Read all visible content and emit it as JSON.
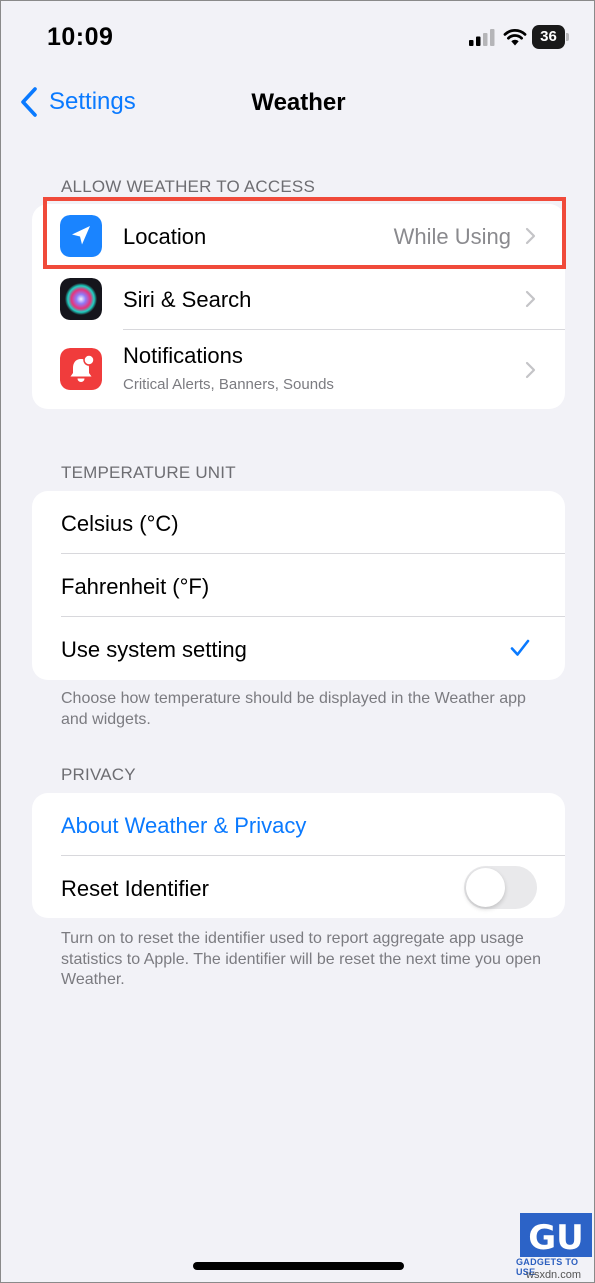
{
  "status_bar": {
    "time": "10:09",
    "battery": "36"
  },
  "nav": {
    "back_label": "Settings",
    "title": "Weather"
  },
  "access_section": {
    "header": "ALLOW WEATHER TO ACCESS",
    "items": [
      {
        "label": "Location",
        "value": "While Using",
        "icon": "location-arrow-icon"
      },
      {
        "label": "Siri & Search",
        "icon": "siri-icon"
      },
      {
        "label": "Notifications",
        "subtitle": "Critical Alerts, Banners, Sounds",
        "icon": "notifications-icon"
      }
    ]
  },
  "temperature_section": {
    "header": "TEMPERATURE UNIT",
    "options": [
      {
        "label": "Celsius (°C)",
        "selected": false
      },
      {
        "label": "Fahrenheit (°F)",
        "selected": false
      },
      {
        "label": "Use system setting",
        "selected": true
      }
    ],
    "footer": "Choose how temperature should be displayed in the Weather app and widgets."
  },
  "privacy_section": {
    "header": "PRIVACY",
    "link_label": "About Weather & Privacy",
    "reset_label": "Reset Identifier",
    "reset_enabled": false,
    "footer": "Turn on to reset the identifier used to report aggregate app usage statistics to Apple. The identifier will be reset the next time you open Weather."
  },
  "watermark": {
    "logo_text": "GU",
    "brand": "GADGETS TO USE",
    "domain": "wsxdn.com"
  },
  "colors": {
    "accent": "#0a7aff",
    "highlight": "#f04a3a",
    "location_icon_bg": "#1a84ff",
    "notifications_icon_bg": "#f03c3c"
  }
}
